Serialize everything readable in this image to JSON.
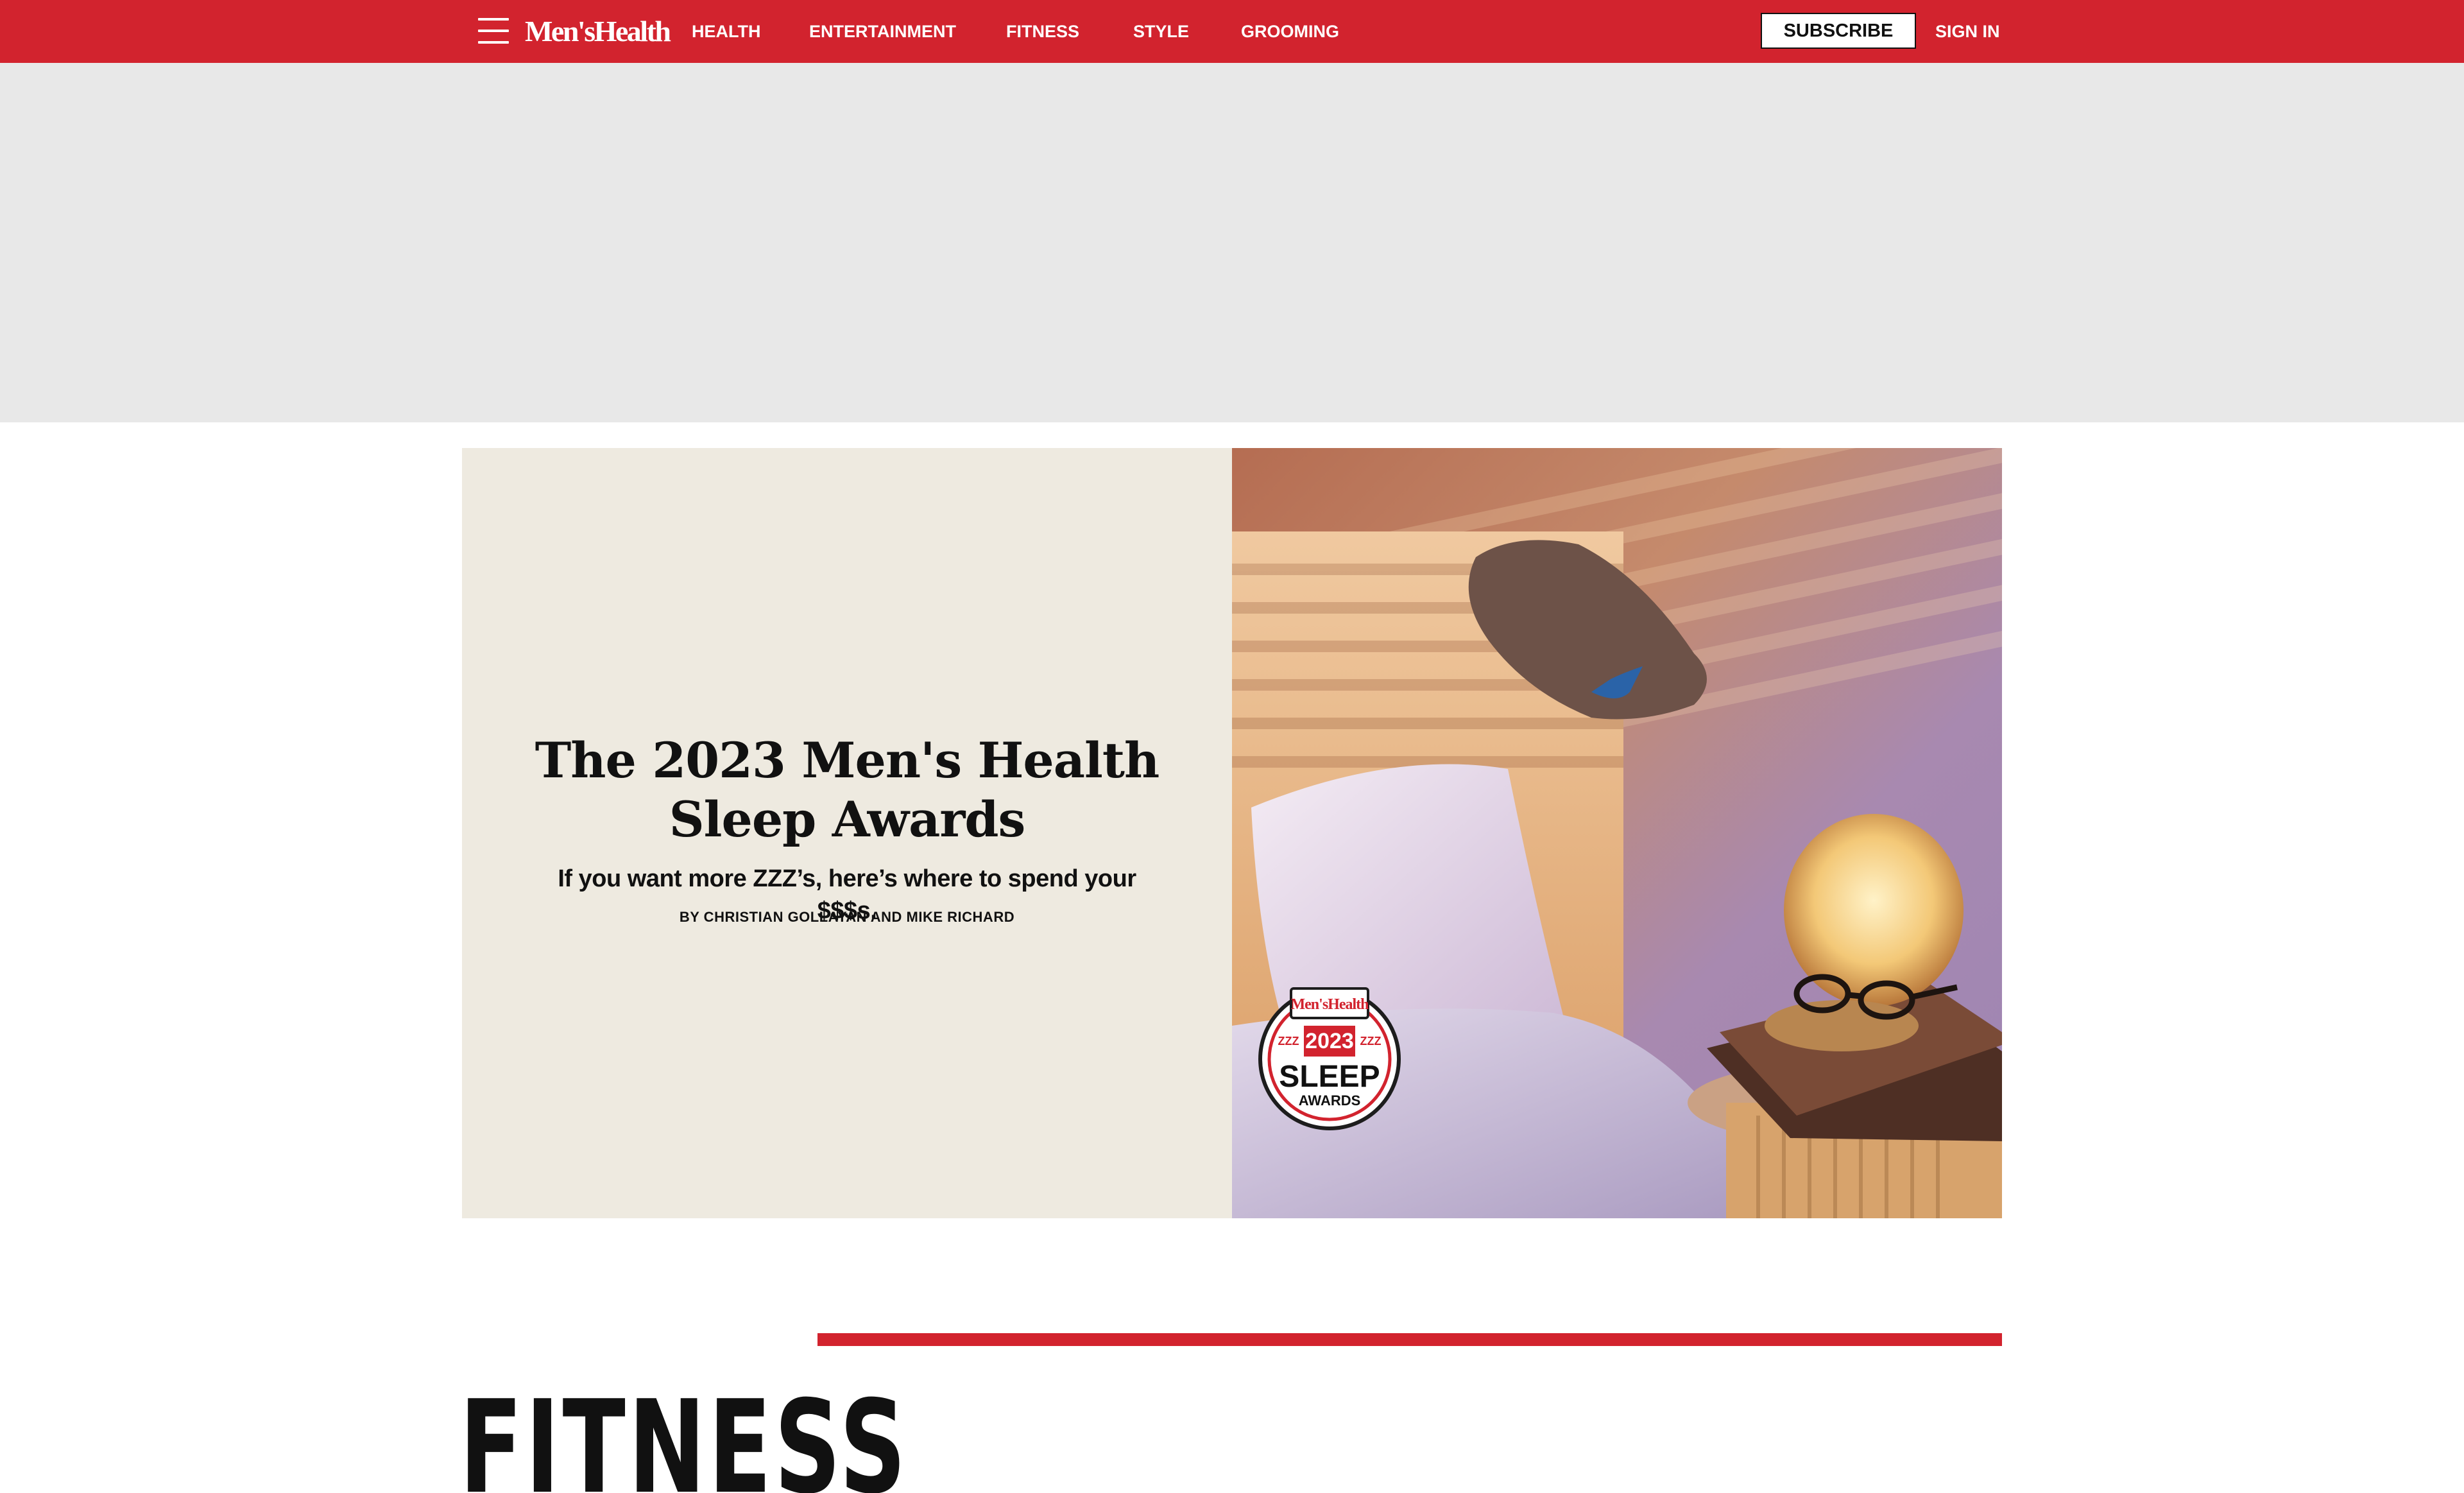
{
  "brand": {
    "logo_text": "Men'sHealth",
    "accent_color": "#d2232e"
  },
  "nav": {
    "menu_icon": "hamburger-menu-icon",
    "links": [
      "HEALTH",
      "ENTERTAINMENT",
      "FITNESS",
      "STYLE",
      "GROOMING"
    ],
    "subscribe_label": "SUBSCRIBE",
    "signin_label": "SIGN IN"
  },
  "hero": {
    "title": "The 2023 Men's Health Sleep Awards",
    "dek": "If you want more ZZZ’s, here’s where to spend your $$$s.",
    "byline": "BY CHRISTIAN GOLLAYAN AND MIKE RICHARD",
    "image_alt": "Bedroom nightstand with glowing lamp, glasses, books and a sleep headband device",
    "badge": {
      "brand": "Men'sHealth",
      "year": "2023",
      "title": "SLEEP",
      "subtitle": "AWARDS",
      "z_marks": "ZZZ"
    }
  },
  "section": {
    "title": "FITNESS"
  }
}
